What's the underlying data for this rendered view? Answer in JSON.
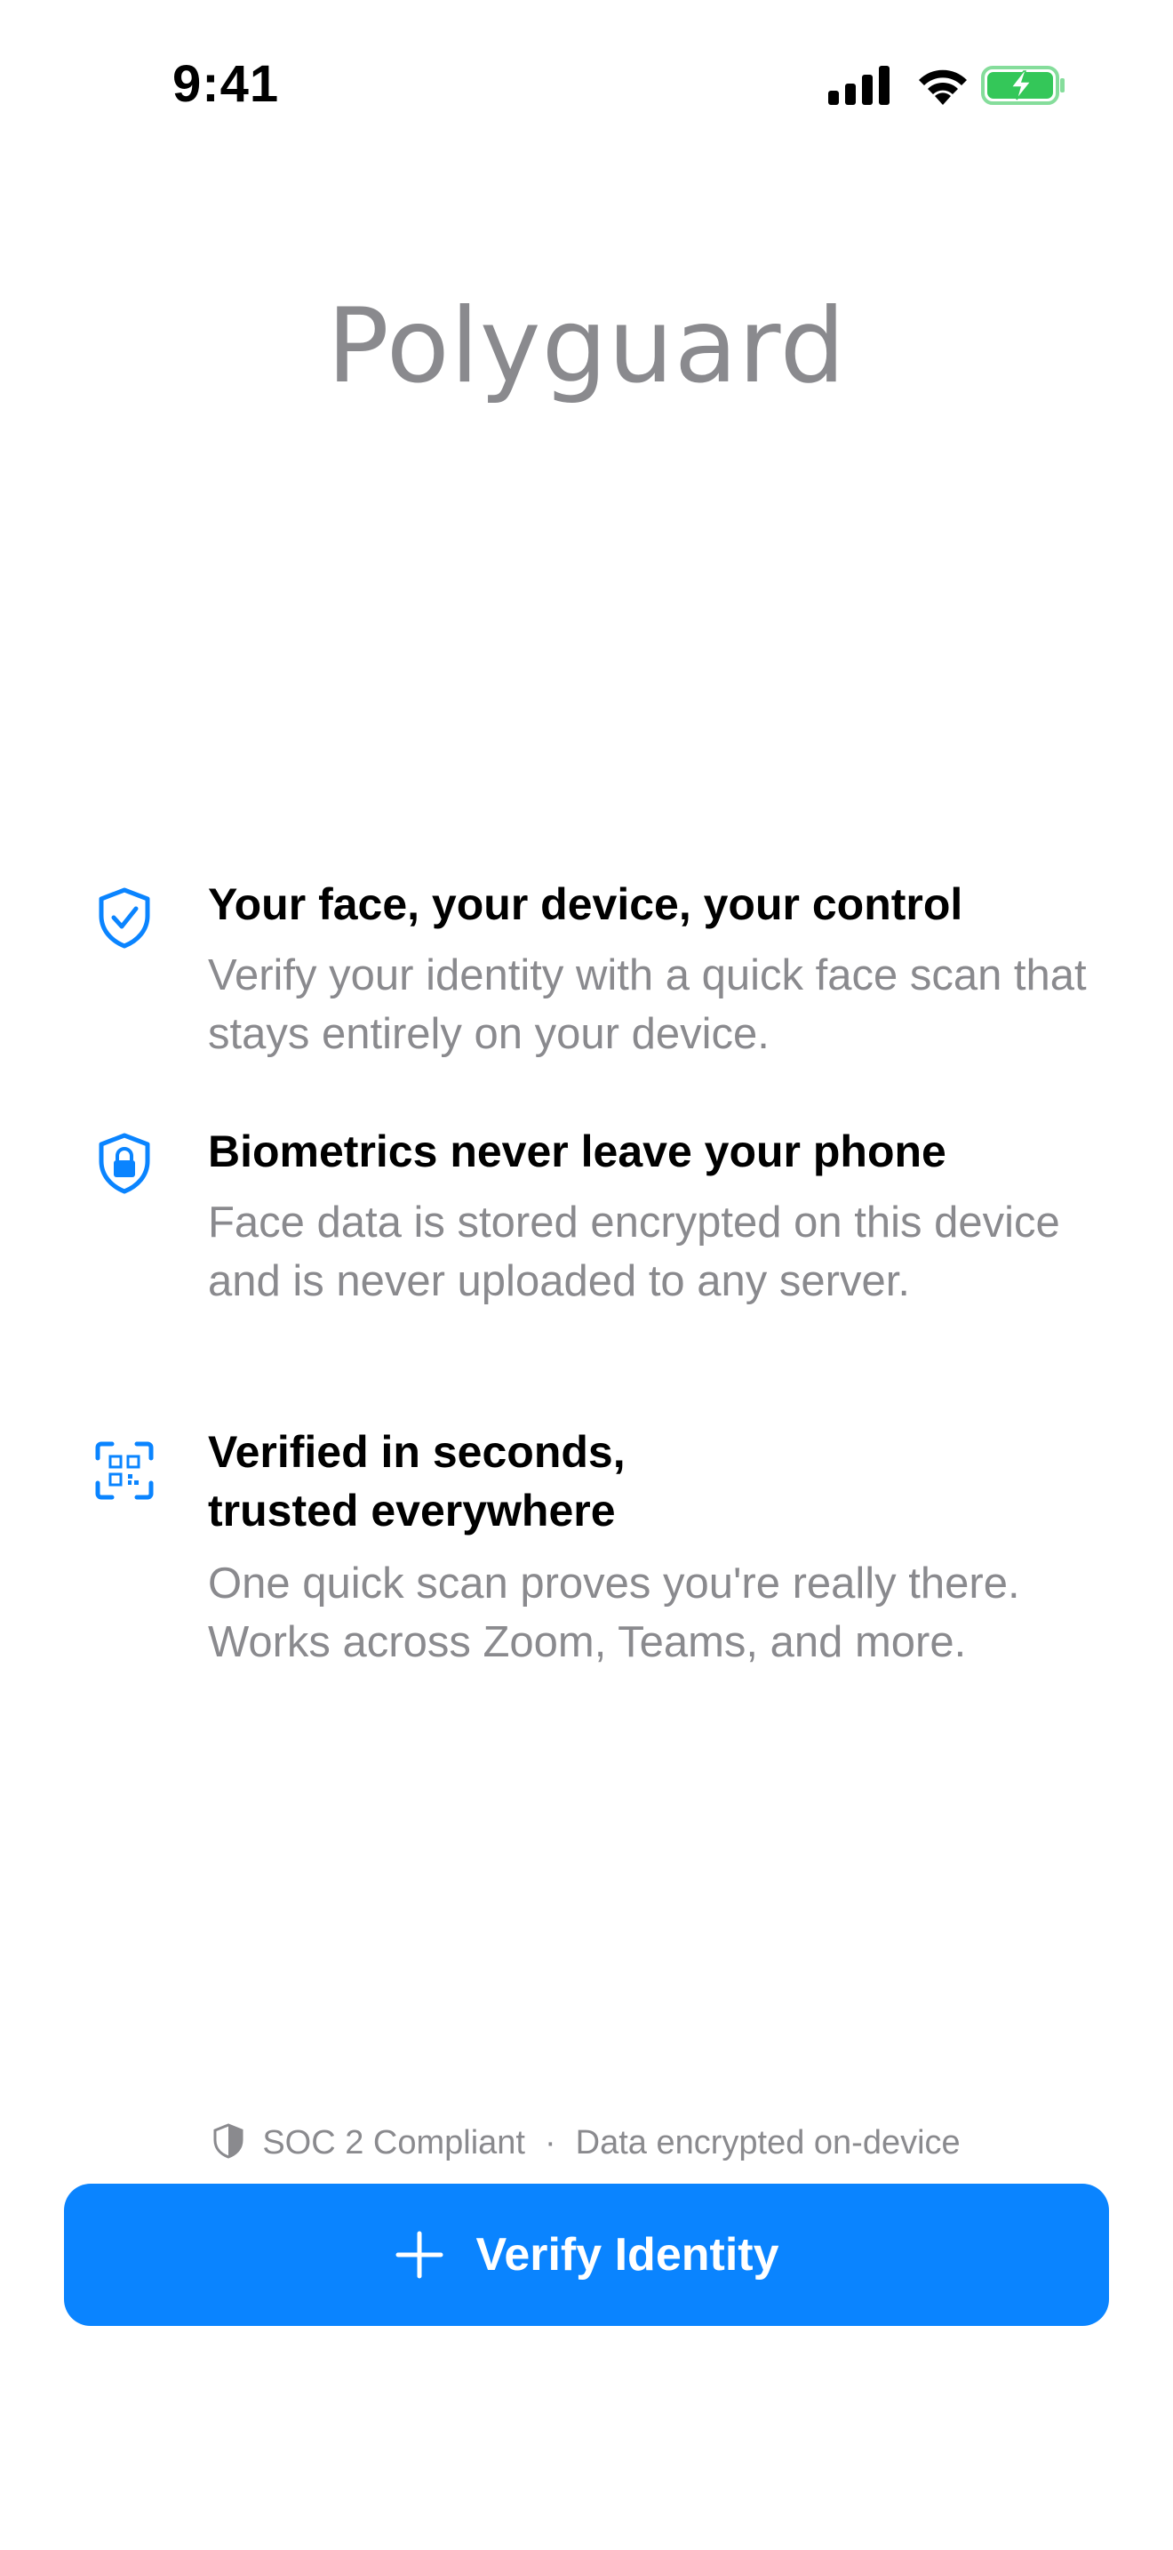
{
  "status_bar": {
    "time": "9:41",
    "icons": [
      "cellular-signal-icon",
      "wifi-icon",
      "battery-charging-icon"
    ],
    "battery_color": "#34c759"
  },
  "app": {
    "title": "Polyguard"
  },
  "features": [
    {
      "icon": "shield-check-icon",
      "title": "Your face, your device, your control",
      "description": "Verify your identity with a quick face scan that stays entirely on your device."
    },
    {
      "icon": "shield-lock-icon",
      "title": "Biometrics never leave your phone",
      "description": "Face data is stored encrypted on this device and is never uploaded to any server."
    },
    {
      "icon": "qr-scan-icon",
      "title_line1": "Verified in seconds,",
      "title_line2": "trusted everywhere",
      "description": "One quick scan proves you're really there. Works across Zoom, Teams, and more."
    }
  ],
  "compliance": {
    "icon": "shield-icon",
    "soc": "SOC 2 Compliant",
    "separator": "·",
    "encryption": "Data encrypted on-device"
  },
  "verify_button": {
    "icon": "plus-icon",
    "label": "Verify Identity"
  },
  "colors": {
    "accent": "#0a84ff",
    "secondary_text": "#8a8a8e"
  }
}
